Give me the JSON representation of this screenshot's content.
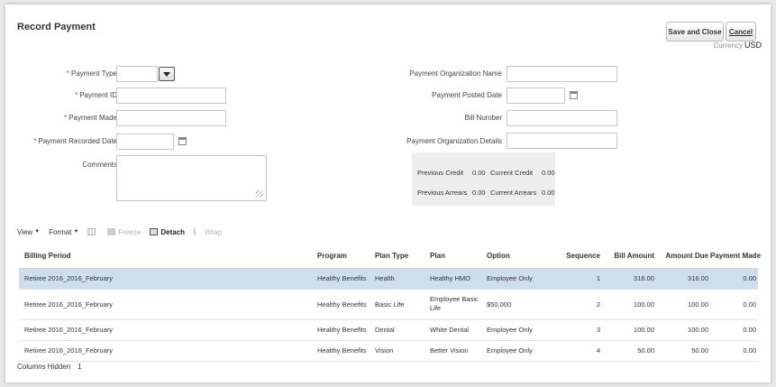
{
  "header": {
    "title": "Record Payment",
    "save_label": "Save and Close",
    "cancel_label": "Cancel",
    "currency_label": "Currency",
    "currency_value": "USD"
  },
  "form": {
    "payment_type_label": "Payment Type",
    "payment_id_label": "Payment ID",
    "payment_made_label": "Payment Made",
    "payment_recorded_date_label": "Payment Recorded Date",
    "comments_label": "Comments",
    "payment_org_name_label": "Payment Organization Name",
    "payment_posted_date_label": "Payment Posted Date",
    "bill_number_label": "Bill Number",
    "payment_org_details_label": "Payment Organization Details",
    "required_mark": "*"
  },
  "credits": {
    "previous_credit_label": "Previous Credit",
    "previous_credit_value": "0.00",
    "current_credit_label": "Current Credit",
    "current_credit_value": "0.00",
    "previous_arrears_label": "Previous Arrears",
    "previous_arrears_value": "0.00",
    "current_arrears_label": "Current Arrears",
    "current_arrears_value": "0.00"
  },
  "toolbar": {
    "view_label": "View",
    "format_label": "Format",
    "freeze_label": "Freeze",
    "detach_label": "Detach",
    "wrap_label": "Wrap"
  },
  "table": {
    "columns": [
      "Billing Period",
      "Program",
      "Plan Type",
      "Plan",
      "Option",
      "Sequence",
      "Bill Amount",
      "Amount Due",
      "Payment Made"
    ],
    "rows": [
      [
        "Retiree 2016_2016_February",
        "Healthy Benefits",
        "Health",
        "Healthy HMO",
        "Employee Only",
        "1",
        "316.00",
        "316.00",
        "0.00"
      ],
      [
        "Retiree 2016_2016_February",
        "Healthy Benefits",
        "Basic Life",
        "Employee Basic Life",
        "$50,000",
        "2",
        "100.00",
        "100.00",
        "0.00"
      ],
      [
        "Retiree 2016_2016_February",
        "Healthy Benefits",
        "Dental",
        "White Dental",
        "Employee Only",
        "3",
        "100.00",
        "100.00",
        "0.00"
      ],
      [
        "Retiree 2016_2016_February",
        "Healthy Benefits",
        "Vision",
        "Better Vision",
        "Employee Only",
        "4",
        "50.00",
        "50.00",
        "0.00"
      ]
    ]
  },
  "footer": {
    "columns_hidden_label": "Columns Hidden",
    "columns_hidden_value": "1"
  },
  "icons": {
    "dropdown": "chevron-down-icon",
    "calendar": "calendar-icon",
    "resize": "resize-grip-icon"
  }
}
